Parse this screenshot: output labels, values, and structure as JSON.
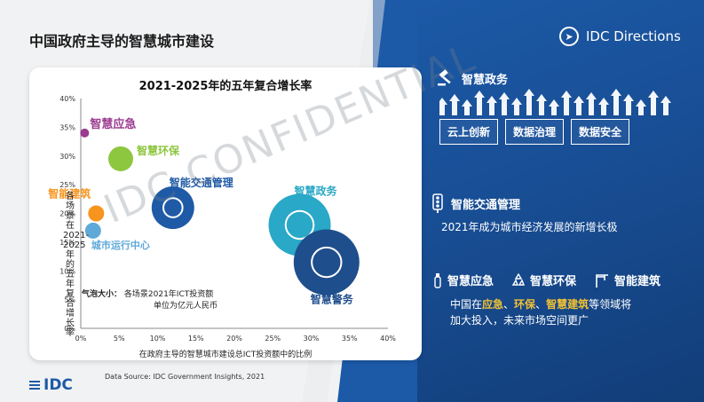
{
  "page": {
    "title": "中国政府主导的智慧城市建设",
    "logo_text": "IDC Directions",
    "source": "Data Source: IDC Government Insights, 2021",
    "footer_logo": "IDC",
    "watermark": "IDC CONFIDENTIAL"
  },
  "chart_data": {
    "type": "scatter",
    "title": "2021-2025年的五年复合增长率",
    "xlabel": "在政府主导的智慧城市建设总ICT投资额中的比例",
    "ylabel": "各场景在2021-2025 年的五年复合增长率",
    "xlim": [
      0,
      40
    ],
    "ylim": [
      0,
      40
    ],
    "x_ticks": [
      "0%",
      "5%",
      "10%",
      "15%",
      "20%",
      "25%",
      "30%",
      "35%",
      "40%"
    ],
    "y_ticks": [
      "0%",
      "5%",
      "10%",
      "15%",
      "20%",
      "25%",
      "30%",
      "35%",
      "40%"
    ],
    "bubble_note_label": "气泡大小：",
    "bubble_note_line1": "各场景2021年ICT投资额",
    "bubble_note_line2": "单位为亿元人民币",
    "points": [
      {
        "name": "智慧应急",
        "x": 0.5,
        "y": 34,
        "size": 5,
        "color": "#9b3b8f"
      },
      {
        "name": "智慧环保",
        "x": 5.2,
        "y": 29.5,
        "size": 14,
        "color": "#8dc63f"
      },
      {
        "name": "智能交通管理",
        "x": 12,
        "y": 21,
        "size": 24,
        "color": "#1f5aa6"
      },
      {
        "name": "智能建筑",
        "x": 2,
        "y": 20,
        "size": 9,
        "color": "#f7941d"
      },
      {
        "name": "城市运行中心",
        "x": 1.6,
        "y": 17,
        "size": 9,
        "color": "#5fa9d8"
      },
      {
        "name": "智慧政务",
        "x": 28.5,
        "y": 18,
        "size": 35,
        "color": "#29a8c7"
      },
      {
        "name": "智慧警务",
        "x": 32,
        "y": 11.5,
        "size": 37,
        "color": "#1f4e8c"
      }
    ]
  },
  "right": {
    "gov_title": "智慧政务",
    "pills": [
      "云上创新",
      "数据治理",
      "数据安全"
    ],
    "traffic_title": "智能交通管理",
    "traffic_text": "2021年成为城市经济发展的新增长极",
    "cat1": "智慧应急",
    "cat2": "智慧环保",
    "cat3": "智能建筑",
    "body_prefix": "中国在",
    "hl1": "应急",
    "sep1": "、",
    "hl2": "环保",
    "sep2": "、",
    "hl3": "智慧建筑",
    "body_suffix": "等领域将",
    "body_line2": "加大投入，未来市场空间更广"
  },
  "colors": {
    "panel_blue": "#1c5aa8",
    "highlight": "#f1c232"
  }
}
